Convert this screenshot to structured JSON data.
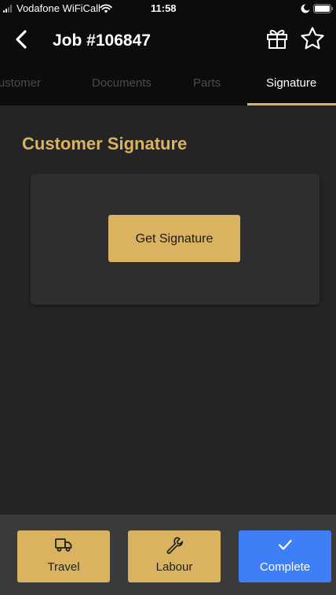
{
  "status_bar": {
    "carrier": "Vodafone WiFiCall",
    "time": "11:58"
  },
  "header": {
    "title": "Job #106847",
    "icons": [
      "back-chevron-icon",
      "gift-icon",
      "star-icon"
    ]
  },
  "tabs": [
    {
      "label": "Customer",
      "active": false
    },
    {
      "label": "Documents",
      "active": false
    },
    {
      "label": "Parts",
      "active": false
    },
    {
      "label": "Signature",
      "active": true
    }
  ],
  "content": {
    "section_title": "Customer Signature",
    "get_signature_label": "Get Signature"
  },
  "bottom_actions": [
    {
      "label": "Travel",
      "icon": "truck-icon"
    },
    {
      "label": "Labour",
      "icon": "wrench-icon"
    },
    {
      "label": "Complete",
      "icon": "checkmark-icon"
    }
  ],
  "colors": {
    "accent": "#d9b35f",
    "primary_blue": "#3e7ef7",
    "background": "#242424",
    "header_background": "#0c0c0c",
    "inactive_tab": "#4b4b4b"
  }
}
